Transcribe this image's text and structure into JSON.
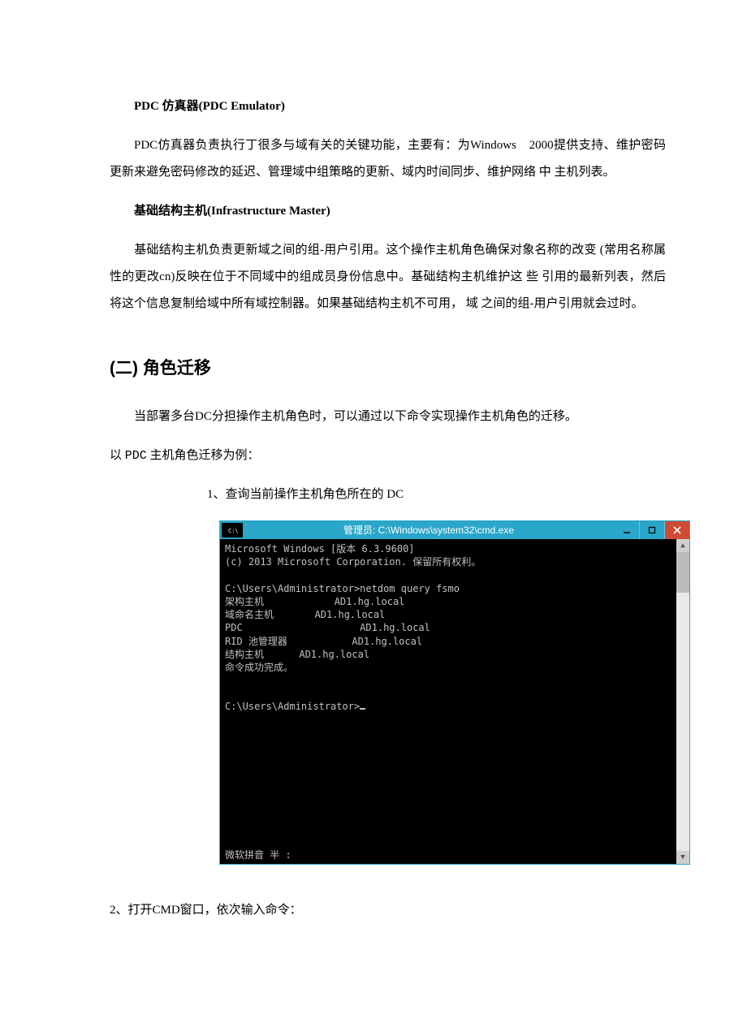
{
  "doc": {
    "h_pdc": "PDC 仿真器(PDC Emulator)",
    "p_pdc": "PDC仿真器负责执行丁很多与域有关的关键功能，主要有：为Windows　2000提供支持、维护密码更新来避免密码修改的延迟、管理域中组策略的更新、域内时间同步、维护网络 中 主机列表。",
    "h_infra": "基础结构主机(Infrastructure Master)",
    "p_infra": "基础结构主机负责更新域之间的组-用户引用。这个操作主机角色确保对象名称的改变 (常用名称属性的更改cn)反映在位于不同域中的组成员身份信息中。基础结构主机维护这 些 引用的最新列表，然后将这个信息复制给域中所有域控制器。如果基础结构主机不可用， 域 之间的组-用户引用就会过时。",
    "h2": "(二)  角色迁移",
    "p_intro": "当部署多台DC分担操作主机角色时，可以通过以下命令实现操作主机角色的迁移。",
    "p_example_pre": "以 ",
    "p_example_mono": "PDC",
    "p_example_post": " 主机角色迁移为例：",
    "step1": "1、查询当前操作主机角色所在的 DC",
    "step2": "2、打开CMD窗口，依次输入命令："
  },
  "cmd": {
    "title": "管理员: C:\\Windows\\system32\\cmd.exe",
    "lines": "Microsoft Windows [版本 6.3.9600]\n(c) 2013 Microsoft Corporation. 保留所有权利。\n\nC:\\Users\\Administrator>netdom query fsmo\n架构主机            AD1.hg.local\n域命名主机       AD1.hg.local\nPDC                    AD1.hg.local\nRID 池管理器           AD1.hg.local\n结构主机      AD1.hg.local\n命令成功完成。\n\n\nC:\\Users\\Administrator>",
    "ime": "微软拼音 半 :"
  }
}
